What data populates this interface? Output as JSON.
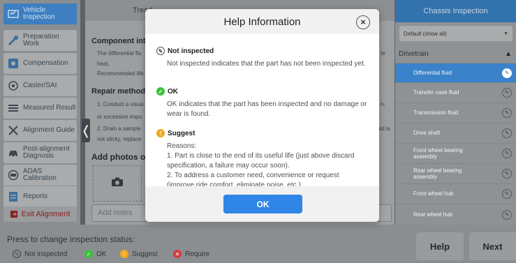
{
  "nav": {
    "items": [
      {
        "label": "Vehicle Inspection",
        "icon": "vehicle-icon"
      },
      {
        "label": "Preparation Work",
        "icon": "wrench-icon"
      },
      {
        "label": "Compensation",
        "icon": "compensation-icon"
      },
      {
        "label": "Caster/SAI",
        "icon": "caster-icon"
      },
      {
        "label": "Measured Result",
        "icon": "result-icon"
      },
      {
        "label": "Alignment Guide",
        "icon": "tools-icon"
      },
      {
        "label": "Post-alignment Diagnosis",
        "icon": "car-icon"
      },
      {
        "label": "ADAS Calibration",
        "icon": "adas-icon"
      },
      {
        "label": "Reports",
        "icon": "report-icon"
      }
    ],
    "exit_label": "Exit Alignment"
  },
  "center": {
    "tab_label": "Tread",
    "component_heading": "Component intr",
    "component_line1": "The differential flu",
    "component_line1_tail": "te",
    "component_line2": "heat.",
    "component_line3": "Recommended life",
    "repair_heading": "Repair method",
    "repair_line1": "1. Conduct a visua",
    "repair_line1_tail": "n,",
    "repair_line2": "or excessive impu",
    "repair_line3": "2. Drain a sample",
    "repair_line3_tail": "uid is",
    "repair_line4": "not sticky, replace",
    "add_photos": "Add photos or",
    "notes_placeholder": "Add notes"
  },
  "right": {
    "header": "Chassis Inspection",
    "filter": "Default (show all)",
    "group": "Drivetrain",
    "parts": [
      "Differential fluid",
      "Transfer case fluid",
      "Transmission fluid",
      "Drive shaft",
      "Front wheel bearing assembly",
      "Rear wheel bearing assembly",
      "Front wheel hub",
      "Rear wheel hub"
    ]
  },
  "bottom": {
    "status_title": "Press to change inspection status:",
    "statuses": [
      "Not inspected",
      "OK",
      "Suggest",
      "Require"
    ],
    "help": "Help",
    "next": "Next"
  },
  "dialog": {
    "title": "Help Information",
    "close": "×",
    "not_inspected_title": "Not inspected",
    "not_inspected_text": "Not inspected indicates that the part has not been inspected yet.",
    "ok_title": "OK",
    "ok_text": "OK indicates that the part has been inspected and no damage or wear is found.",
    "suggest_title": "Suggest",
    "suggest_reasons": "Reasons:",
    "suggest_1": "1. Part is close to the end of its useful life (just above discard specification, a failure may occur soon).",
    "suggest_2": "2. To address a customer need, convenience or request",
    "suggest_2_cut": "(improve ride comfort, eliminate noise, etc.)",
    "ok_button": "OK"
  },
  "colors": {
    "accent": "#2f86e6",
    "ok": "#3cc13c",
    "suggest": "#f3a81c",
    "require": "#d23c3c"
  }
}
